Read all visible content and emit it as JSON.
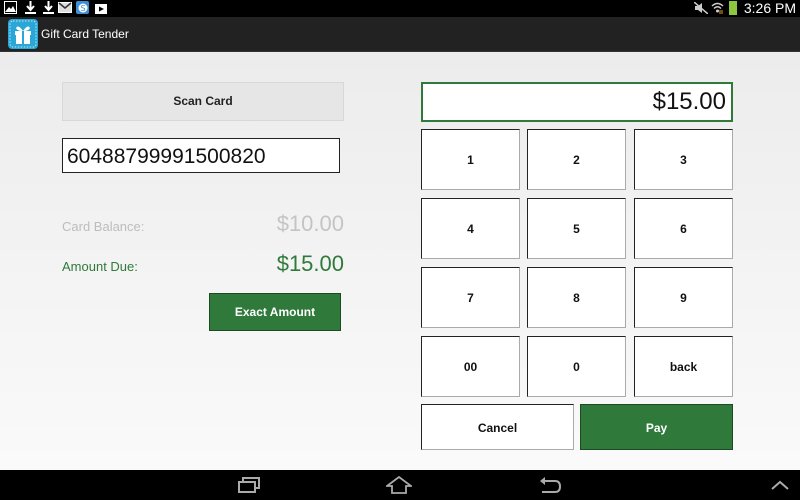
{
  "status_bar": {
    "left_icons": [
      "image-icon",
      "download-icon",
      "download-icon",
      "gmail-icon",
      "skype-icon",
      "play-store-icon"
    ],
    "right_icons": [
      "mute-icon",
      "wifi-icon",
      "battery-icon"
    ],
    "time": "3:26 PM",
    "battery_color": "#8cc63f"
  },
  "app_bar": {
    "icon": "gift-icon",
    "title": "Gift Card Tender"
  },
  "left_panel": {
    "scan_button": "Scan Card",
    "card_number": "60488799991500820",
    "card_balance_label": "Card Balance:",
    "card_balance_value": "$10.00",
    "amount_due_label": "Amount Due:",
    "amount_due_value": "$15.00",
    "exact_amount_button": "Exact Amount"
  },
  "keypad": {
    "display_value": "$15.00",
    "keys": [
      "1",
      "2",
      "3",
      "4",
      "5",
      "6",
      "7",
      "8",
      "9",
      "00",
      "0",
      "back"
    ],
    "cancel_button": "Cancel",
    "pay_button": "Pay"
  },
  "nav_bar": {
    "buttons": [
      "recent-apps-icon",
      "home-icon",
      "back-icon",
      "chevron-up-icon"
    ]
  },
  "colors": {
    "accent_green": "#2f7a3b",
    "balance_gray": "#bdbdbd",
    "app_icon_blue": "#2aa7d6"
  }
}
